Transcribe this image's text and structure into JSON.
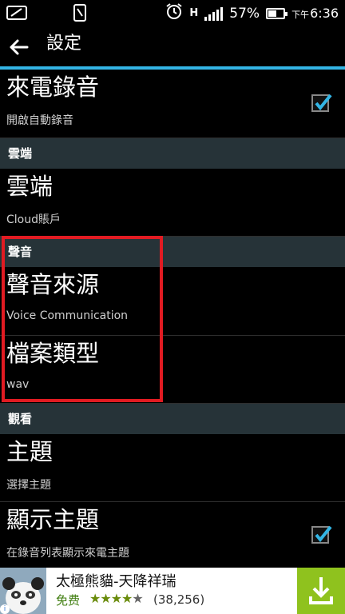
{
  "status_bar": {
    "battery_text": "57%",
    "ampm": "下午",
    "time": "6:36",
    "network_type": "H",
    "icons": [
      "tablet-icon",
      "phone-icon",
      "alarm-icon",
      "signal-icon",
      "battery-icon"
    ],
    "battery_level": 0.57
  },
  "action_bar": {
    "title": "設定"
  },
  "items": {
    "record": {
      "title": "來電錄音",
      "subtitle": "開啟自動錄音",
      "checked": true
    },
    "cloud_section": "雲端",
    "cloud": {
      "title": "雲端",
      "subtitle": "Cloud賬戶"
    },
    "sound_section": "聲音",
    "voice_source": {
      "title": "聲音來源",
      "subtitle": "Voice Communication"
    },
    "file_type": {
      "title": "檔案類型",
      "subtitle": "wav"
    },
    "view_section": "觀看",
    "theme": {
      "title": "主題",
      "subtitle": "選擇主題"
    },
    "show_theme": {
      "title": "顯示主題",
      "subtitle": "在錄音列表顯示來電主題",
      "checked": true
    }
  },
  "ad": {
    "title": "太極熊貓-天降祥瑞",
    "price": "免费",
    "rating_stars": 4,
    "rating_count": "(38,256)"
  },
  "colors": {
    "accent": "#33b5e5",
    "section_bg": "#263338",
    "highlight": "#e11b22",
    "download": "#8fc21e"
  }
}
